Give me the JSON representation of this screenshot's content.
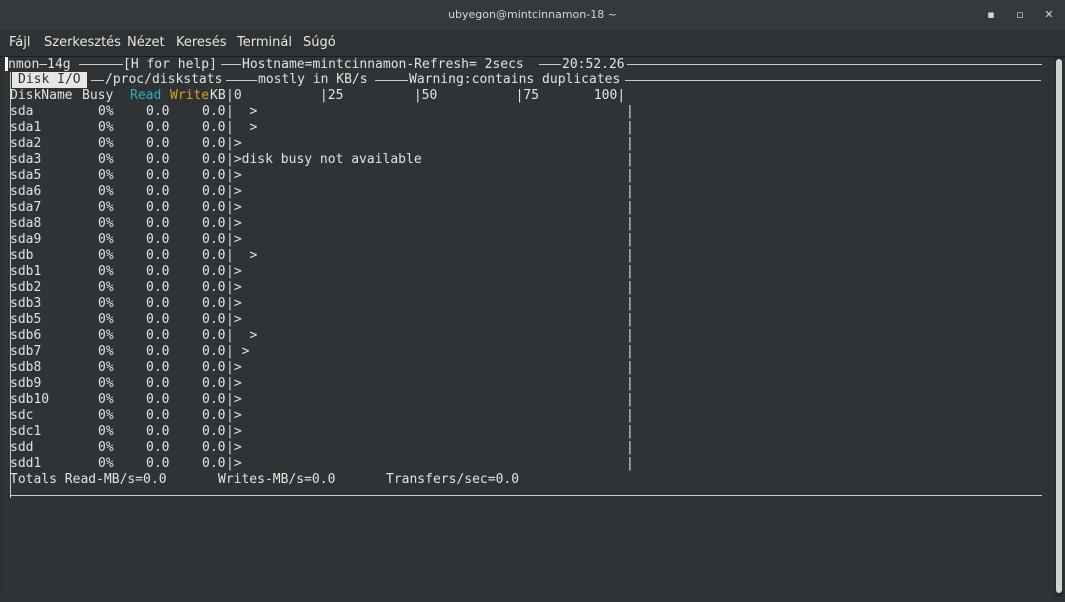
{
  "window": {
    "title": "ubyegon@mintcinnamon-18 ~",
    "minimize_glyph": "▪",
    "maximize_glyph": "▫",
    "close_glyph": "✕"
  },
  "menu": {
    "items": [
      "Fájl",
      "Szerkesztés",
      "Nézet",
      "Keresés",
      "Terminál",
      "Súgó"
    ]
  },
  "nmon": {
    "header_left": "nmon—14g",
    "header_help": "[H for help]",
    "header_host": "Hostname=mintcinnamon-Refresh= 2secs",
    "header_time": "20:52.26",
    "panel_title": "Disk I/O",
    "panel_source": "/proc/diskstats",
    "panel_unit": "mostly in KB/s",
    "panel_warning": "Warning:contains duplicates",
    "col_diskname": "DiskName",
    "col_busy": "Busy",
    "col_read": "Read",
    "col_write": "Write",
    "col_kb": "KB",
    "scale": "|0          |25         |50          |75       100|",
    "rows": [
      {
        "name": "sda",
        "busy": "0%",
        "read": "0.0",
        "write": "0.0",
        "graph": "|  >"
      },
      {
        "name": "sda1",
        "busy": "0%",
        "read": "0.0",
        "write": "0.0",
        "graph": "|  >"
      },
      {
        "name": "sda2",
        "busy": "0%",
        "read": "0.0",
        "write": "0.0",
        "graph": "|>"
      },
      {
        "name": "sda3",
        "busy": "0%",
        "read": "0.0",
        "write": "0.0",
        "graph": "|>disk busy not available"
      },
      {
        "name": "sda5",
        "busy": "0%",
        "read": "0.0",
        "write": "0.0",
        "graph": "|>"
      },
      {
        "name": "sda6",
        "busy": "0%",
        "read": "0.0",
        "write": "0.0",
        "graph": "|>"
      },
      {
        "name": "sda7",
        "busy": "0%",
        "read": "0.0",
        "write": "0.0",
        "graph": "|>"
      },
      {
        "name": "sda8",
        "busy": "0%",
        "read": "0.0",
        "write": "0.0",
        "graph": "|>"
      },
      {
        "name": "sda9",
        "busy": "0%",
        "read": "0.0",
        "write": "0.0",
        "graph": "|>"
      },
      {
        "name": "sdb",
        "busy": "0%",
        "read": "0.0",
        "write": "0.0",
        "graph": "|  >"
      },
      {
        "name": "sdb1",
        "busy": "0%",
        "read": "0.0",
        "write": "0.0",
        "graph": "|>"
      },
      {
        "name": "sdb2",
        "busy": "0%",
        "read": "0.0",
        "write": "0.0",
        "graph": "|>"
      },
      {
        "name": "sdb3",
        "busy": "0%",
        "read": "0.0",
        "write": "0.0",
        "graph": "|>"
      },
      {
        "name": "sdb5",
        "busy": "0%",
        "read": "0.0",
        "write": "0.0",
        "graph": "|>"
      },
      {
        "name": "sdb6",
        "busy": "0%",
        "read": "0.0",
        "write": "0.0",
        "graph": "|  >"
      },
      {
        "name": "sdb7",
        "busy": "0%",
        "read": "0.0",
        "write": "0.0",
        "graph": "| >"
      },
      {
        "name": "sdb8",
        "busy": "0%",
        "read": "0.0",
        "write": "0.0",
        "graph": "|>"
      },
      {
        "name": "sdb9",
        "busy": "0%",
        "read": "0.0",
        "write": "0.0",
        "graph": "|>"
      },
      {
        "name": "sdb10",
        "busy": "0%",
        "read": "0.0",
        "write": "0.0",
        "graph": "|>"
      },
      {
        "name": "sdc",
        "busy": "0%",
        "read": "0.0",
        "write": "0.0",
        "graph": "|>"
      },
      {
        "name": "sdc1",
        "busy": "0%",
        "read": "0.0",
        "write": "0.0",
        "graph": "|>"
      },
      {
        "name": "sdd",
        "busy": "0%",
        "read": "0.0",
        "write": "0.0",
        "graph": "|>"
      },
      {
        "name": "sdd1",
        "busy": "0%",
        "read": "0.0",
        "write": "0.0",
        "graph": "|>"
      }
    ],
    "graph_end": "|",
    "totals_read": "Totals Read-MB/s=0.0",
    "totals_write": "Writes-MB/s=0.0",
    "totals_transfers": "Transfers/sec=0.0"
  },
  "colors": {
    "read": "#2ab0c1",
    "write": "#d7a30c",
    "background": "#2f3335"
  }
}
